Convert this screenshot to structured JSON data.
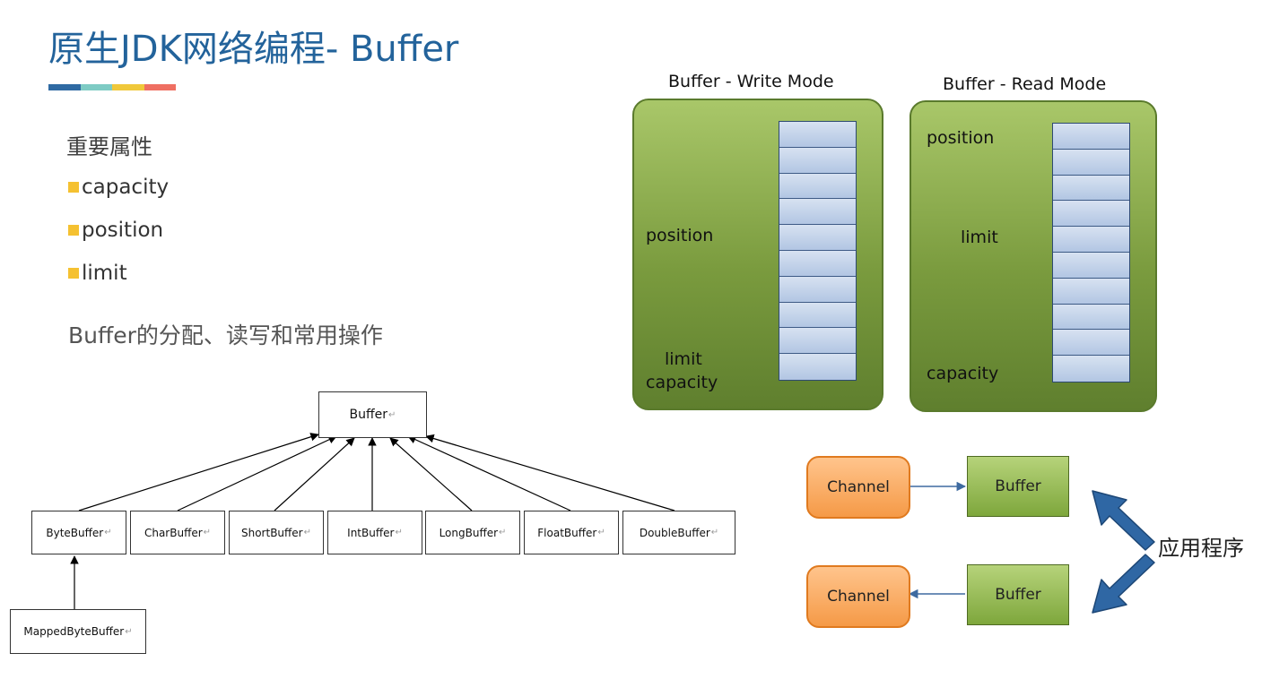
{
  "title": "原生JDK网络编程- Buffer",
  "accent_colors": [
    "#2f6aa3",
    "#7ecbc4",
    "#f0c83a",
    "#ef6f62"
  ],
  "props": {
    "heading": "重要属性",
    "bullet_color": "#f5c131",
    "items": [
      "capacity",
      "position",
      "limit"
    ]
  },
  "ops_text": "Buffer的分配、读写和常用操作",
  "hierarchy": {
    "root": "Buffer",
    "return_mark": "↵",
    "children": [
      "ByteBuffer",
      "CharBuffer",
      "ShortBuffer",
      "IntBuffer",
      "LongBuffer",
      "FloatBuffer",
      "DoubleBuffer"
    ],
    "grandchild": "MappedByteBuffer"
  },
  "write_mode": {
    "title": "Buffer - Write Mode",
    "position_label": "position",
    "limit_label": "limit",
    "capacity_label": "capacity"
  },
  "read_mode": {
    "title": "Buffer - Read Mode",
    "position_label": "position",
    "limit_label": "limit",
    "capacity_label": "capacity"
  },
  "io": {
    "channel_top": "Channel",
    "buffer_top": "Buffer",
    "channel_bottom": "Channel",
    "buffer_bottom": "Buffer",
    "app_label": "应用程序"
  }
}
